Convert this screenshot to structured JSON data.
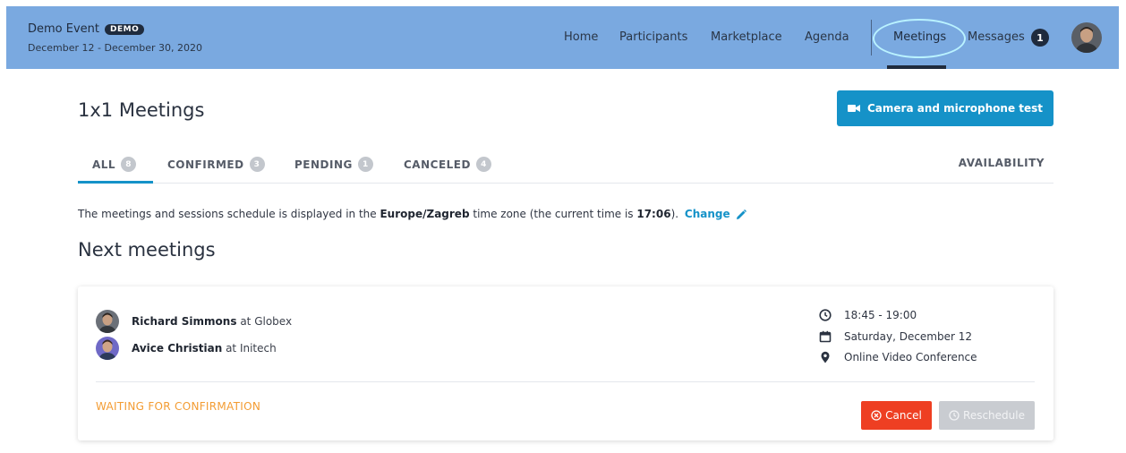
{
  "header": {
    "event_name": "Demo Event",
    "demo_badge": "DEMO",
    "event_dates": "December 12 - December 30, 2020",
    "nav": {
      "home": "Home",
      "participants": "Participants",
      "marketplace": "Marketplace",
      "agenda": "Agenda",
      "meetings": "Meetings",
      "messages": "Messages",
      "messages_count": "1"
    },
    "active_item": "Meetings"
  },
  "page": {
    "title": "1x1 Meetings",
    "camera_button": "Camera and microphone test"
  },
  "tabs": {
    "all": {
      "label": "ALL",
      "count": "8"
    },
    "confirmed": {
      "label": "CONFIRMED",
      "count": "3"
    },
    "pending": {
      "label": "PENDING",
      "count": "1"
    },
    "canceled": {
      "label": "CANCELED",
      "count": "4"
    },
    "availability": "AVAILABILITY",
    "active": "ALL"
  },
  "timezone": {
    "prefix": "The meetings and sessions schedule is displayed in the ",
    "zone": "Europe/Zagreb",
    "middle": " time zone (the current time is ",
    "time": "17:06",
    "suffix": ").",
    "change_label": "Change"
  },
  "next_meetings": {
    "title": "Next meetings",
    "meeting": {
      "participant_1": {
        "name": "Richard Simmons",
        "at": " at ",
        "company": "Globex"
      },
      "participant_2": {
        "name": "Avice Christian",
        "at": " at ",
        "company": "Initech"
      },
      "time": "18:45 - 19:00",
      "date": "Saturday, December 12",
      "location": "Online Video Conference",
      "status": "WAITING FOR CONFIRMATION",
      "cancel_label": "Cancel",
      "reschedule_label": "Reschedule"
    }
  },
  "colors": {
    "header_bg": "#7aa9e0",
    "accent": "#1592c8",
    "cancel": "#ee3f22",
    "status_pending": "#f39c33",
    "disabled": "#c9ccd1"
  },
  "icons": {
    "camera": "video-camera-icon",
    "edit": "pencil-icon",
    "time": "clock-icon",
    "date": "calendar-icon",
    "location": "map-pin-icon",
    "cancel": "cancel-circle-icon",
    "reschedule": "clock-icon"
  }
}
